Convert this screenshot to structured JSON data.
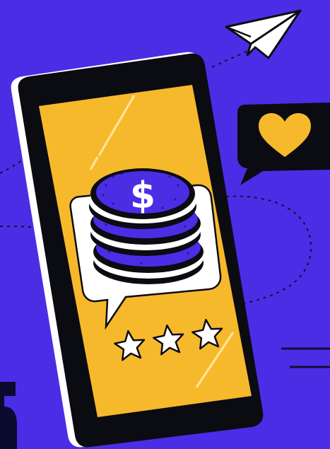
{
  "coin": {
    "symbol": "$"
  },
  "rating": {
    "stars": 3,
    "max": 3
  },
  "colors": {
    "background": "#4b2de6",
    "phone_body": "#0b0b12",
    "screen": "#f7b92c",
    "coin": "#4b2de6",
    "coin_edge": "#ffffff",
    "heart": "#f7b92c",
    "bubble": "#ffffff"
  },
  "icons": [
    "paper-plane-icon",
    "heart-icon",
    "dollar-coin-icon",
    "star-icon"
  ]
}
